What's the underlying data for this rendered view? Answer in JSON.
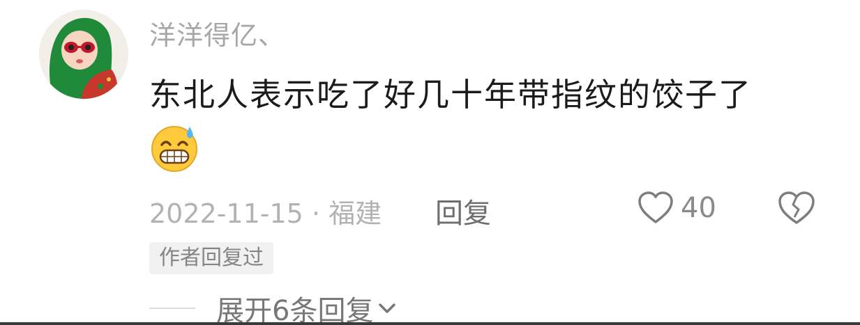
{
  "comment": {
    "username": "洋洋得亿、",
    "text": "东北人表示吃了好几十年带指纹的饺子了",
    "emoji": "grinning-sweat-face",
    "date_location": "2022-11-15 · 福建",
    "reply_label": "回复",
    "like_count": "40",
    "author_badge": "作者回复过",
    "expand_replies": "展开6条回复",
    "colors": {
      "username": "#a7a7a7",
      "text": "#1b1b1b",
      "meta": "#b2b2b2",
      "badge_bg": "#f1f1f1"
    }
  }
}
